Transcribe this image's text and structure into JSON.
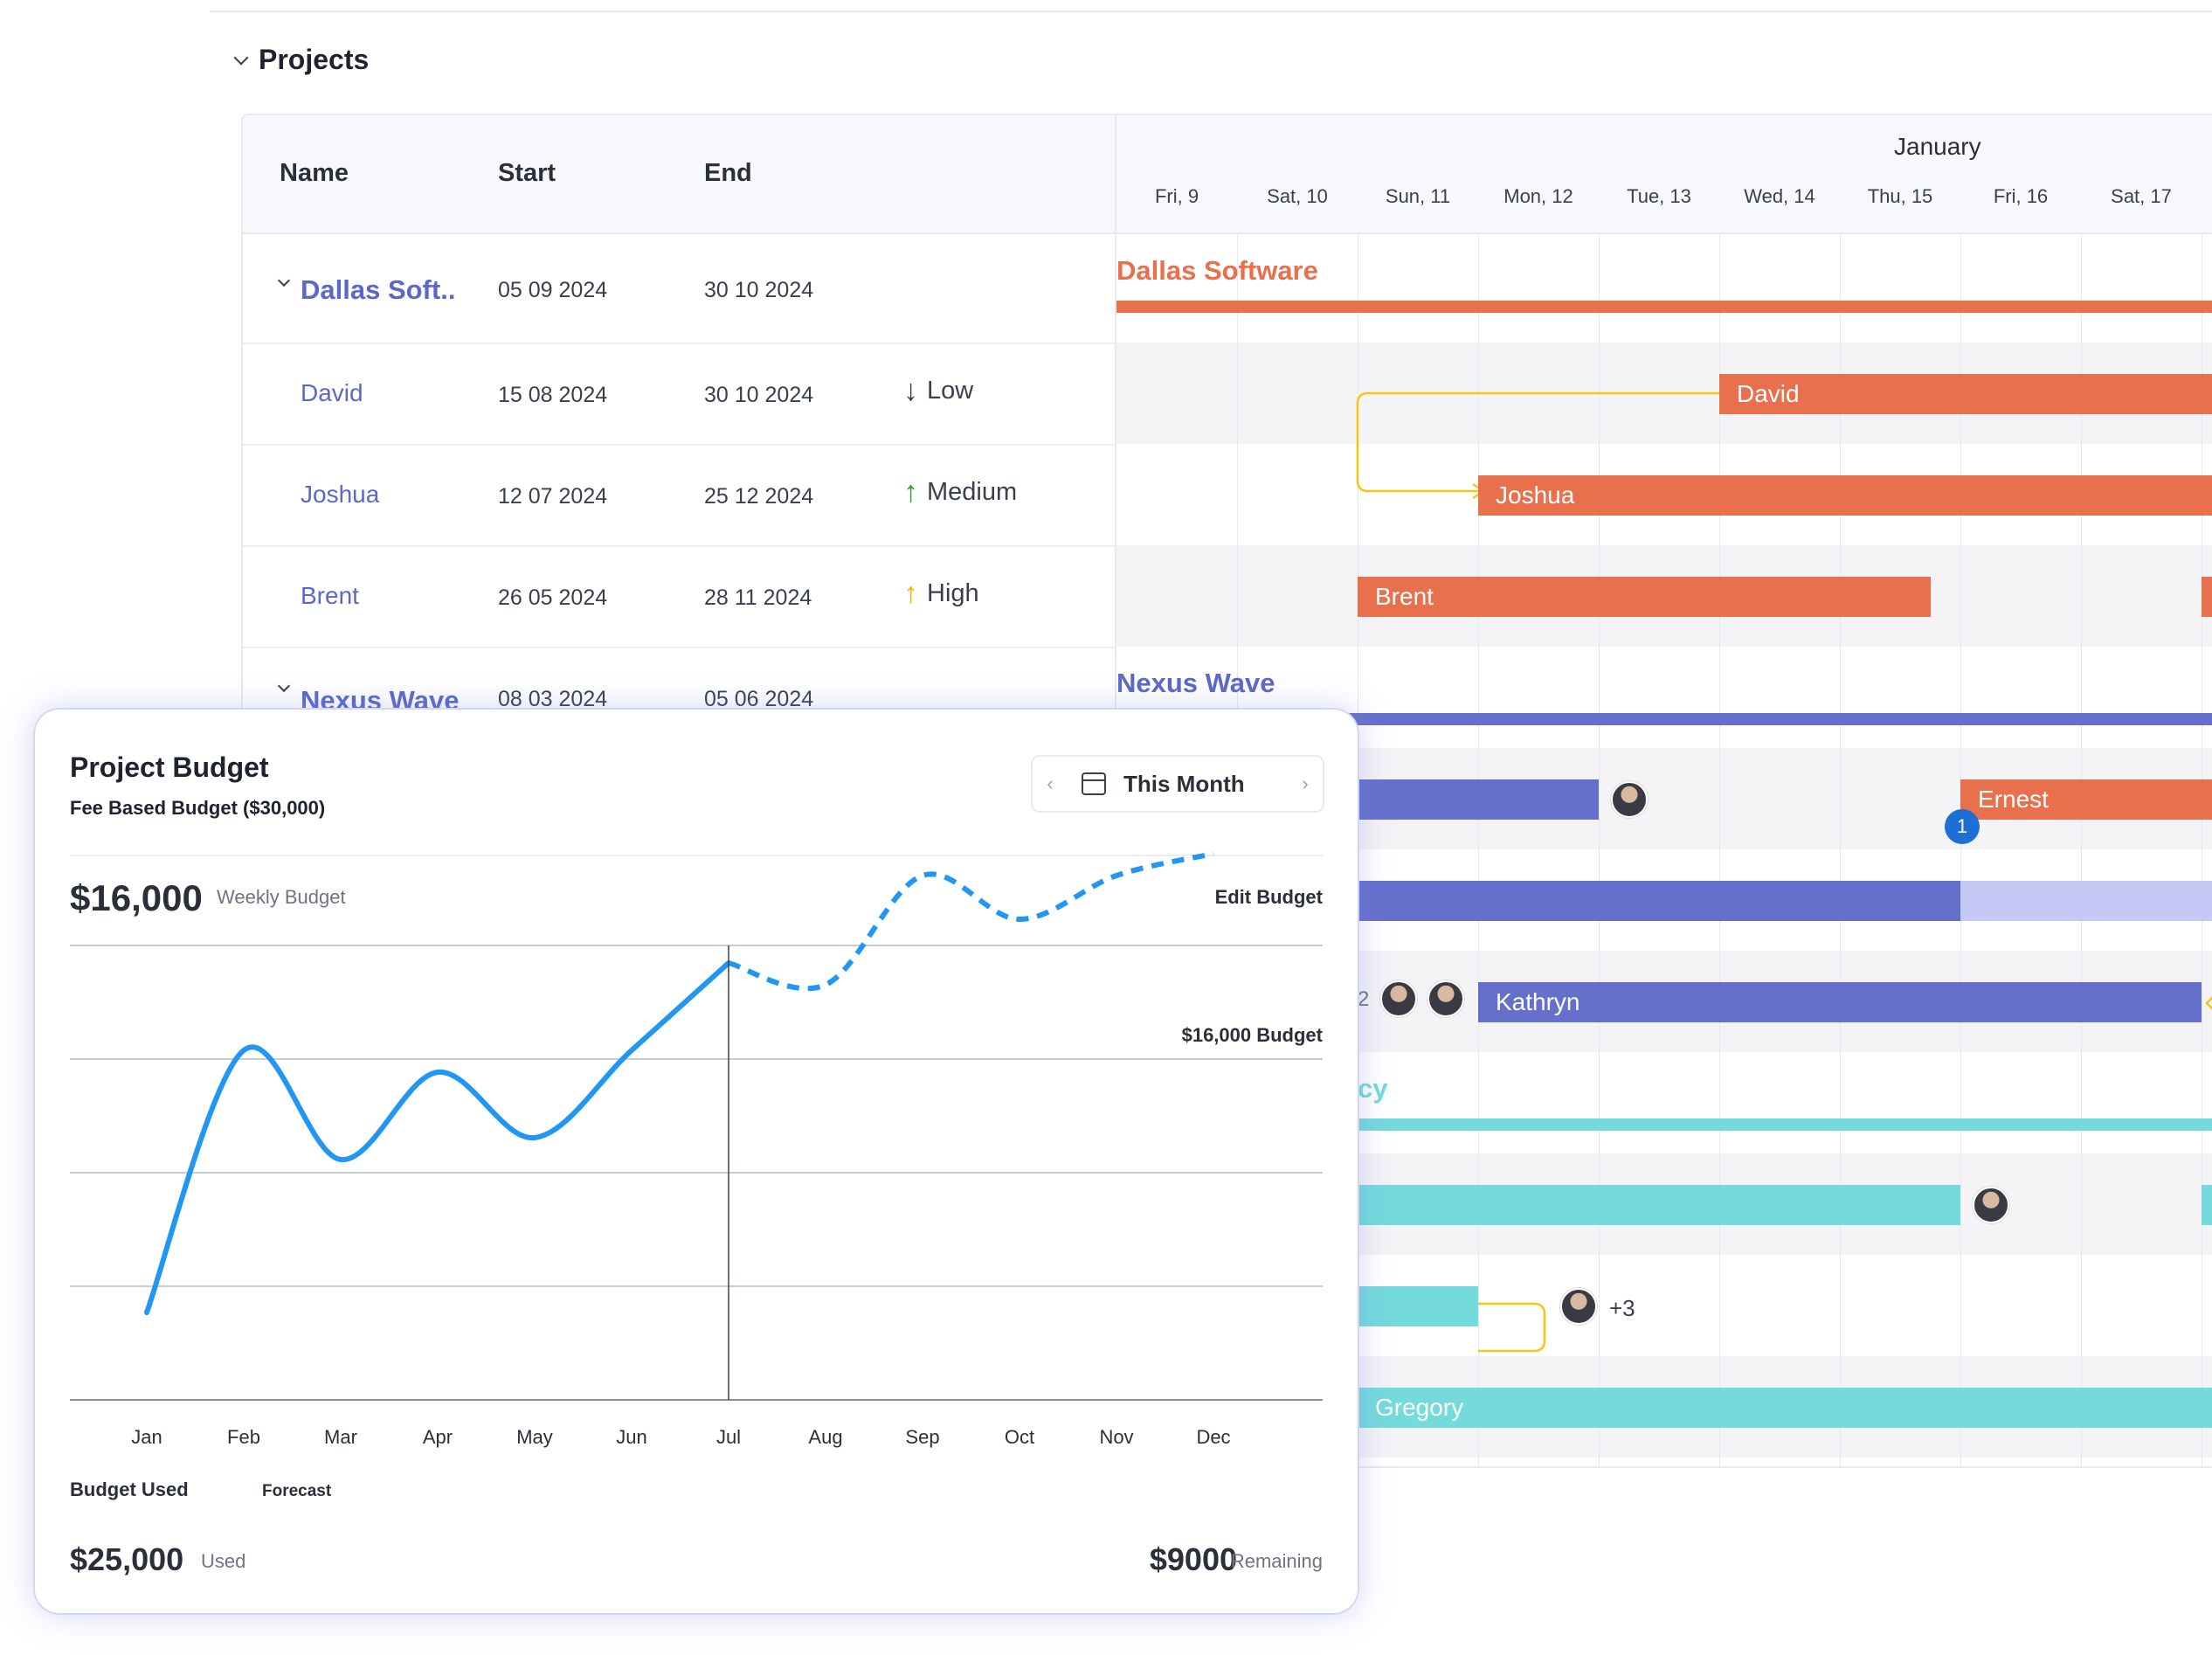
{
  "section": {
    "title": "Projects"
  },
  "table": {
    "headers": {
      "name": "Name",
      "start": "Start",
      "end": "End"
    },
    "rows": [
      {
        "name": "Dallas Soft..",
        "start": "05 09 2024",
        "end": "30 10 2024",
        "priority": ""
      },
      {
        "name": "David",
        "start": "15 08 2024",
        "end": "30 10 2024",
        "priority": "Low",
        "arrow": "↓"
      },
      {
        "name": "Joshua",
        "start": "12 07 2024",
        "end": "25 12 2024",
        "priority": "Medium",
        "arrow": "↑"
      },
      {
        "name": "Brent",
        "start": "26 05 2024",
        "end": "28 11 2024",
        "priority": "High",
        "arrow": "↑"
      },
      {
        "name": "Nexus Wave",
        "start": "08 03 2024",
        "end": "05 06 2024",
        "priority": ""
      }
    ]
  },
  "gantt": {
    "month": "January",
    "days": [
      "Fri, 9",
      "Sat, 10",
      "Sun, 11",
      "Mon, 12",
      "Tue, 13",
      "Wed, 14",
      "Thu, 15",
      "Fri, 16",
      "Sat, 17"
    ],
    "groups": {
      "dallas": "Dallas Software",
      "nexus": "Nexus Wave",
      "third_partial": "cy"
    },
    "bars": {
      "david": "David",
      "joshua": "Joshua",
      "brent": "Brent",
      "ernest": "Ernest",
      "kathryn": "Kathryn",
      "gregory": "Gregory"
    },
    "badge": "1",
    "more_count": "+3",
    "partial_count": "2",
    "colors": {
      "orange": "#e8704d",
      "blue": "#6570cc",
      "cyan": "#74dadc",
      "connector": "#f5c518"
    }
  },
  "budget": {
    "title": "Project Budget",
    "subtitle": "Fee Based Budget ($30,000)",
    "period": "This Month",
    "amount": "$16,000",
    "amount_label": "Weekly Budget",
    "edit": "Edit Budget",
    "budget_line_label": "$16,000 Budget",
    "legend_used": "Budget Used",
    "legend_forecast": "Forecast",
    "used_amount": "$25,000",
    "used_label": "Used",
    "remaining_amount": "$9000",
    "remaining_label": "Remaining"
  },
  "chart_data": {
    "type": "line",
    "categories": [
      "Jan",
      "Feb",
      "Mar",
      "Apr",
      "May",
      "Jun",
      "Jul",
      "Aug",
      "Sep",
      "Oct",
      "Nov",
      "Dec"
    ],
    "series": [
      {
        "name": "Budget Used",
        "values": [
          4,
          16,
          11,
          15,
          12,
          16,
          20
        ]
      },
      {
        "name": "Forecast",
        "values": [
          null,
          null,
          null,
          null,
          null,
          null,
          20,
          19,
          24,
          22,
          24,
          25
        ]
      }
    ],
    "ylim": [
      0,
      40
    ],
    "budget_line": 16,
    "grid": true,
    "colors": {
      "line": "#2196f3"
    }
  }
}
